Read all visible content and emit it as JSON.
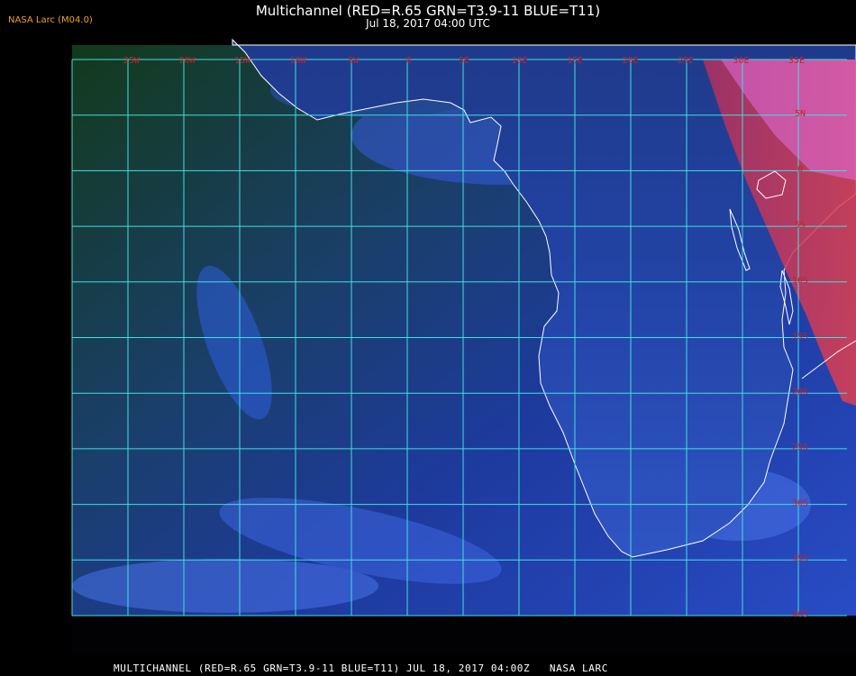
{
  "header": {
    "source_label": "NASA Larc (M04.0)",
    "title": "Multichannel (RED=R.65 GRN=T3.9-11 BLUE=T11)",
    "subtitle": "Jul 18, 2017 04:00 UTC"
  },
  "footer": {
    "caption": "MULTICHANNEL (RED=R.65 GRN=T3.9-11 BLUE=T11) JUL 18, 2017 04:00Z   NASA LARC"
  },
  "map": {
    "longitude_labels": [
      "25W",
      "20W",
      "15W",
      "10W",
      "5W",
      "0",
      "5E",
      "10E",
      "15E",
      "20E",
      "25E",
      "30E",
      "35E"
    ],
    "latitude_labels": [
      "5N",
      "0",
      "5S",
      "10S",
      "15S",
      "20S",
      "25S",
      "30S",
      "35S",
      "40S"
    ],
    "colors": {
      "grid": "#40e0e0",
      "coastline": "#ffffff",
      "tick_labels": "#c8202a",
      "ocean_tone": "#1d3a9e",
      "land_tone": "#1a3d14",
      "daylight_terminator": "#e03060"
    }
  }
}
